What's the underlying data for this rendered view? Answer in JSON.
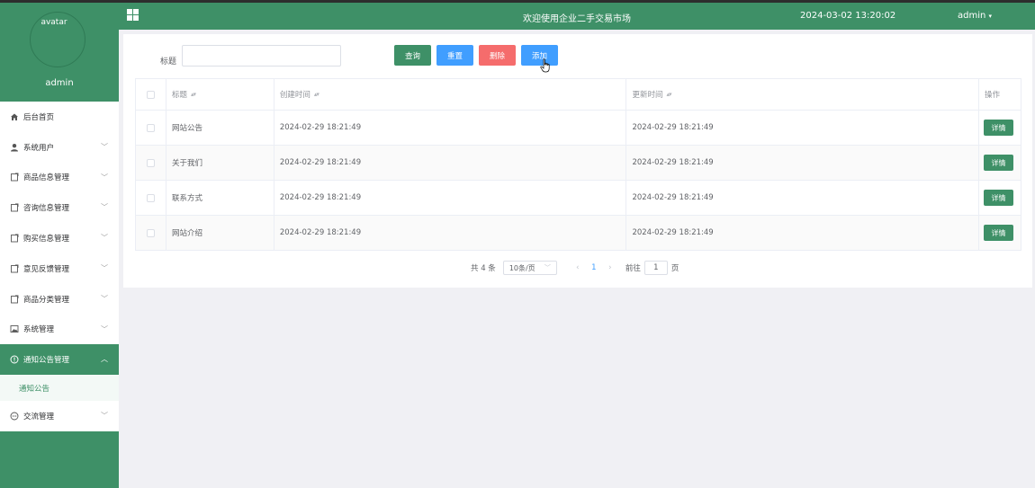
{
  "sidebar": {
    "avatar_text": "avatar",
    "username": "admin",
    "items": [
      {
        "label": "后台首页",
        "icon": "home-icon"
      },
      {
        "label": "系统用户",
        "icon": "user-icon"
      },
      {
        "label": "商品信息管理",
        "icon": "document-icon"
      },
      {
        "label": "咨询信息管理",
        "icon": "document-icon"
      },
      {
        "label": "购买信息管理",
        "icon": "document-icon"
      },
      {
        "label": "意见反馈管理",
        "icon": "document-icon"
      },
      {
        "label": "商品分类管理",
        "icon": "document-icon"
      },
      {
        "label": "系统管理",
        "icon": "picture-icon"
      },
      {
        "label": "通知公告管理",
        "icon": "warning-circle-icon"
      },
      {
        "label": "交流管理",
        "icon": "chat-icon"
      }
    ],
    "submenu": {
      "label": "通知公告"
    }
  },
  "header": {
    "title": "欢迎使用企业二手交易市场",
    "datetime": "2024-03-02 13:20:02",
    "user": "admin"
  },
  "search": {
    "label": "标题",
    "value": "",
    "placeholder": ""
  },
  "actions": {
    "query": "查询",
    "reset": "重置",
    "delete": "删除",
    "add": "添加"
  },
  "table": {
    "columns": [
      "标题",
      "创建时间",
      "更新时间",
      "操作"
    ],
    "rows": [
      {
        "title": "网站公告",
        "created": "2024-02-29 18:21:49",
        "updated": "2024-02-29 18:21:49",
        "action": "详情"
      },
      {
        "title": "关于我们",
        "created": "2024-02-29 18:21:49",
        "updated": "2024-02-29 18:21:49",
        "action": "详情"
      },
      {
        "title": "联系方式",
        "created": "2024-02-29 18:21:49",
        "updated": "2024-02-29 18:21:49",
        "action": "详情"
      },
      {
        "title": "网站介绍",
        "created": "2024-02-29 18:21:49",
        "updated": "2024-02-29 18:21:49",
        "action": "详情"
      }
    ]
  },
  "pagination": {
    "total": "共 4 条",
    "page_size": "10条/页",
    "current_page": "1",
    "goto_label": "前往",
    "goto_value": "1",
    "page_unit": "页"
  },
  "colors": {
    "primary": "#3e9067",
    "blue": "#409eff",
    "danger": "#f56c6c"
  }
}
